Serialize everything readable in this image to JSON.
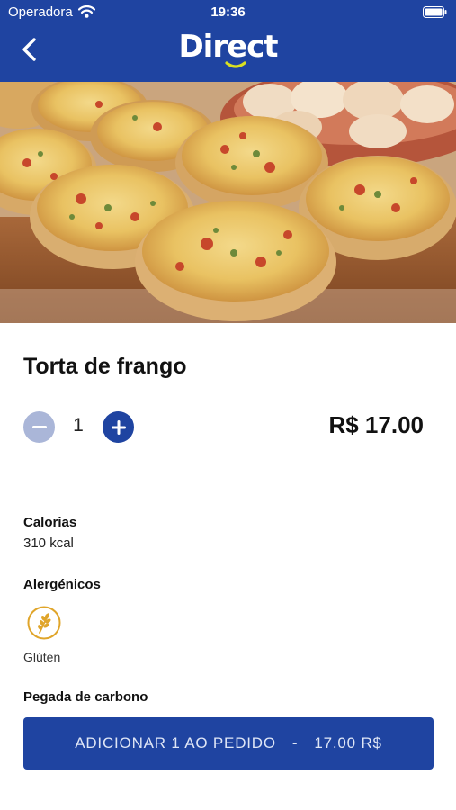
{
  "status_bar": {
    "carrier": "Operadora",
    "time": "19:36"
  },
  "header": {
    "logo_text": "Direct",
    "back_icon": "chevron-left-icon"
  },
  "product": {
    "name": "Torta de frango",
    "quantity": "1",
    "price": "R$ 17.00"
  },
  "details": {
    "calories_label": "Calorias",
    "calories_value": "310 kcal",
    "allergens_label": "Alergénicos",
    "allergens": [
      {
        "label": "Glúten",
        "icon": "wheat-icon"
      }
    ],
    "carbon_label": "Pegada de carbono"
  },
  "cta": {
    "text": "ADICIONAR 1 AO PEDIDO",
    "separator": "-",
    "amount": "17.00 R$"
  },
  "colors": {
    "brand_blue": "#1f44a1",
    "stepper_disabled": "#aab6d8",
    "logo_accent": "#d9e021",
    "allergen_gold": "#e0a52a"
  }
}
